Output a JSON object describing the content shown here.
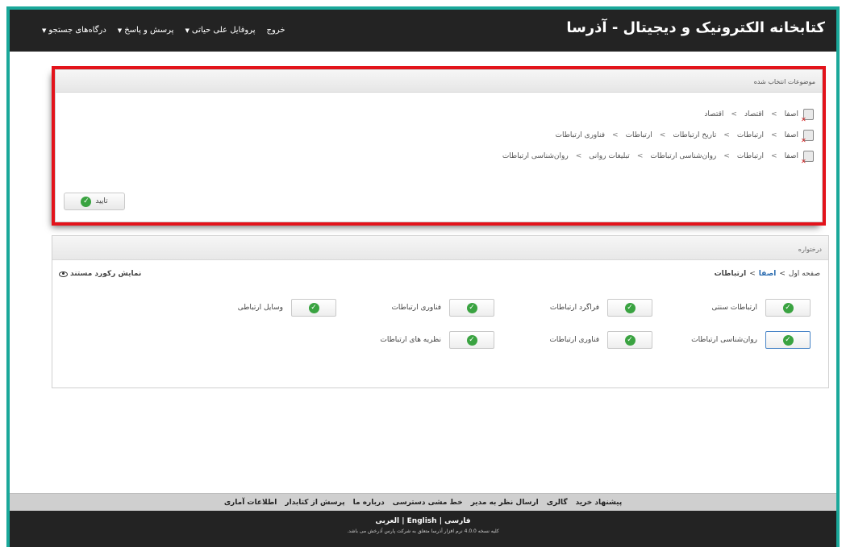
{
  "header": {
    "site_title": "کتابخانه الکترونیک و دیجیتال - آذرسا",
    "nav": [
      {
        "label": "درگاه‌های جستجو"
      },
      {
        "label": "پرسش و پاسخ"
      },
      {
        "label": "پروفایل علی حیاتی"
      },
      {
        "label": "خروج"
      }
    ]
  },
  "selected_subjects": {
    "title": "موضوعات انتخاب شده",
    "items": [
      {
        "path": [
          "اصفا",
          "اقتصاد",
          "اقتصاد"
        ]
      },
      {
        "path": [
          "اصفا",
          "ارتباطات",
          "تاریخ ارتباطات",
          "ارتباطات",
          "فناوری ارتباطات"
        ]
      },
      {
        "path": [
          "اصفا",
          "ارتباطات",
          "روان‌شناسی ارتباطات",
          "تبلیغات روانی",
          "روان‌شناسی ارتباطات"
        ]
      }
    ],
    "separator": ">",
    "confirm_label": "تایید"
  },
  "tree": {
    "title": "درختواره",
    "breadcrumb": {
      "first": "صفحه اول",
      "sep": ">",
      "link": "اصفا",
      "current": "ارتباطات"
    },
    "show_record": "نمایش رکورد مستند",
    "nodes": [
      {
        "label": "ارتباطات سنتی"
      },
      {
        "label": "فراگرد ارتباطات"
      },
      {
        "label": "فناوری ارتباطات"
      },
      {
        "label": "وسایل ارتباطی"
      },
      {
        "label": "روان‌شناسی ارتباطات"
      },
      {
        "label": "فناوری ارتباطات"
      },
      {
        "label": "نظریه های ارتباطات"
      }
    ]
  },
  "footer": {
    "links": [
      {
        "label": "پیشنهاد خرید"
      },
      {
        "label": "گالری"
      },
      {
        "label": "ارسال نظر به مدیر"
      },
      {
        "label": "خط مشی دسترسی"
      },
      {
        "label": "درباره ما"
      },
      {
        "label": "پرسش از کتابدار"
      },
      {
        "label": "اطلاعات آماری"
      }
    ],
    "languages": {
      "fa": "فارسی",
      "en": "English",
      "ar": "العربی",
      "sep": "|"
    },
    "copyright": "کلیه نسخه 4.0.0 نرم افزار آذرسا متعلق به شرکت پارس آذرخش می باشد."
  }
}
